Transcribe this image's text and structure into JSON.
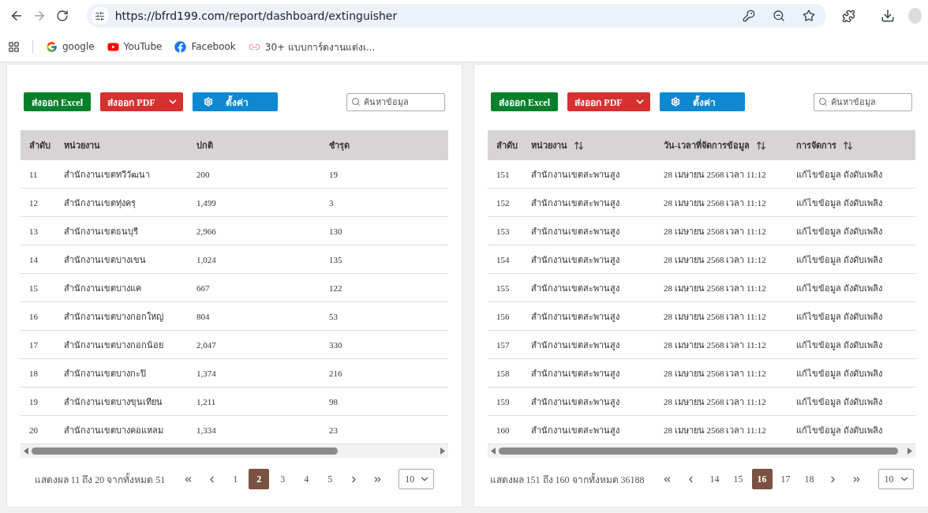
{
  "browser": {
    "url": "https://bfrd199.com/report/dashboard/extinguisher",
    "bookmarks": [
      {
        "kind": "google",
        "label": "google"
      },
      {
        "kind": "youtube",
        "label": "YouTube"
      },
      {
        "kind": "facebook",
        "label": "Facebook"
      },
      {
        "kind": "link",
        "label": "30+ แบบการ์ดงานแต่งเ..."
      }
    ]
  },
  "panels": [
    {
      "buttons": {
        "excel": "ส่งออก Excel",
        "pdf": "ส่งออก PDF",
        "settings": "ตั้งค่า"
      },
      "search": {
        "placeholder": "ค้นหาข้อมูล"
      },
      "table": {
        "columns": [
          {
            "label": "ลำดับ",
            "sortable": false
          },
          {
            "label": "หน่วยงาน",
            "sortable": false
          },
          {
            "label": "ปกติ",
            "sortable": false
          },
          {
            "label": "ชำรุด",
            "sortable": false
          }
        ],
        "rows": [
          [
            "11",
            "สำนักงานเขตทวีวัฒนา",
            "200",
            "19"
          ],
          [
            "12",
            "สำนักงานเขตทุ่งครุ",
            "1,499",
            "3"
          ],
          [
            "13",
            "สำนักงานเขตธนบุรี",
            "2,966",
            "130"
          ],
          [
            "14",
            "สำนักงานเขตบางเขน",
            "1,024",
            "135"
          ],
          [
            "15",
            "สำนักงานเขตบางแค",
            "667",
            "122"
          ],
          [
            "16",
            "สำนักงานเขตบางกอกใหญ่",
            "804",
            "53"
          ],
          [
            "17",
            "สำนักงานเขตบางกอกน้อย",
            "2,047",
            "330"
          ],
          [
            "18",
            "สำนักงานเขตบางกะปิ",
            "1,374",
            "216"
          ],
          [
            "19",
            "สำนักงานเขตบางขุนเทียน",
            "1,211",
            "98"
          ],
          [
            "20",
            "สำนักงานเขตบางคอแหลม",
            "1,334",
            "23"
          ]
        ]
      },
      "pagination": {
        "summary": "แสดงผล 11 ถึง 20 จากทั้งหมด 51",
        "pages": [
          {
            "label": "1",
            "selected": false
          },
          {
            "label": "2",
            "selected": true
          },
          {
            "label": "3",
            "selected": false
          },
          {
            "label": "4",
            "selected": false
          },
          {
            "label": "5",
            "selected": false
          }
        ],
        "page_size": "10"
      }
    },
    {
      "buttons": {
        "excel": "ส่งออก Excel",
        "pdf": "ส่งออก PDF",
        "settings": "ตั้งค่า"
      },
      "search": {
        "placeholder": "ค้นหาข้อมูล"
      },
      "table": {
        "columns": [
          {
            "label": "ลำดับ",
            "sortable": false
          },
          {
            "label": "หน่วยงาน",
            "sortable": true
          },
          {
            "label": "วัน-เวลาที่จัดการข้อมูล",
            "sortable": true
          },
          {
            "label": "การจัดการ",
            "sortable": true
          }
        ],
        "rows": [
          [
            "151",
            "สำนักงานเขตสะพานสูง",
            "28 เมษายน 2568 เวลา 11:12",
            "แก้ไขข้อมูล ถังดับเพลิง"
          ],
          [
            "152",
            "สำนักงานเขตสะพานสูง",
            "28 เมษายน 2568 เวลา 11:12",
            "แก้ไขข้อมูล ถังดับเพลิง"
          ],
          [
            "153",
            "สำนักงานเขตสะพานสูง",
            "28 เมษายน 2568 เวลา 11:12",
            "แก้ไขข้อมูล ถังดับเพลิง"
          ],
          [
            "154",
            "สำนักงานเขตสะพานสูง",
            "28 เมษายน 2568 เวลา 11:12",
            "แก้ไขข้อมูล ถังดับเพลิง"
          ],
          [
            "155",
            "สำนักงานเขตสะพานสูง",
            "28 เมษายน 2568 เวลา 11:12",
            "แก้ไขข้อมูล ถังดับเพลิง"
          ],
          [
            "156",
            "สำนักงานเขตสะพานสูง",
            "28 เมษายน 2568 เวลา 11:12",
            "แก้ไขข้อมูล ถังดับเพลิง"
          ],
          [
            "157",
            "สำนักงานเขตสะพานสูง",
            "28 เมษายน 2568 เวลา 11:12",
            "แก้ไขข้อมูล ถังดับเพลิง"
          ],
          [
            "158",
            "สำนักงานเขตสะพานสูง",
            "28 เมษายน 2568 เวลา 11:12",
            "แก้ไขข้อมูล ถังดับเพลิง"
          ],
          [
            "159",
            "สำนักงานเขตสะพานสูง",
            "28 เมษายน 2568 เวลา 11:12",
            "แก้ไขข้อมูล ถังดับเพลิง"
          ],
          [
            "160",
            "สำนักงานเขตสะพานสูง",
            "28 เมษายน 2568 เวลา 11:12",
            "แก้ไขข้อมูล ถังดับเพลิง"
          ]
        ]
      },
      "pagination": {
        "summary": "แสดงผล 151 ถึง 160 จากทั้งหมด 36188",
        "pages": [
          {
            "label": "14",
            "selected": false
          },
          {
            "label": "15",
            "selected": false
          },
          {
            "label": "16",
            "selected": true
          },
          {
            "label": "17",
            "selected": false
          },
          {
            "label": "18",
            "selected": false
          }
        ],
        "page_size": "10"
      }
    }
  ]
}
